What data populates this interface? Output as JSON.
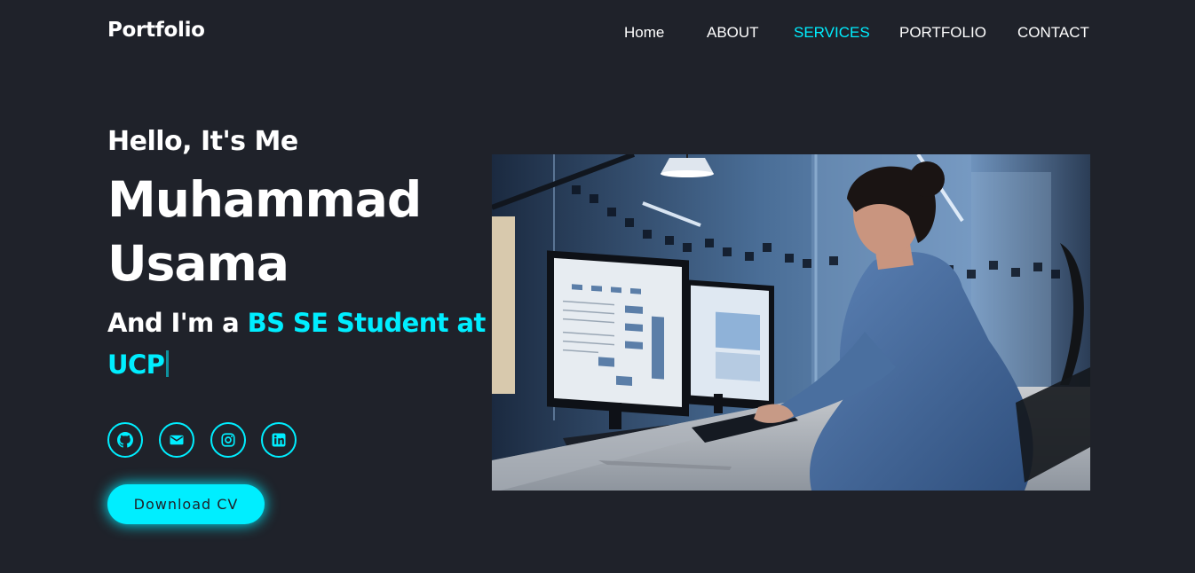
{
  "header": {
    "logo": "Portfolio",
    "nav": [
      {
        "label": "Home",
        "active": false
      },
      {
        "label": "ABOUT",
        "active": false
      },
      {
        "label": "SERVICES",
        "active": true
      },
      {
        "label": "PORTFOLIO",
        "active": false
      },
      {
        "label": "CONTACT",
        "active": false
      }
    ]
  },
  "hero": {
    "greeting": "Hello, It's Me",
    "name": "Muhammad Usama",
    "role_prefix": "And I'm a ",
    "role_highlight": "BS SE Student at UCP"
  },
  "socials": [
    {
      "icon": "github-icon"
    },
    {
      "icon": "mail-icon"
    },
    {
      "icon": "instagram-icon"
    },
    {
      "icon": "linkedin-icon"
    }
  ],
  "cta": {
    "download_label": "Download CV"
  },
  "colors": {
    "background": "#1f222a",
    "accent": "#00eeff",
    "text": "#ffffff"
  }
}
